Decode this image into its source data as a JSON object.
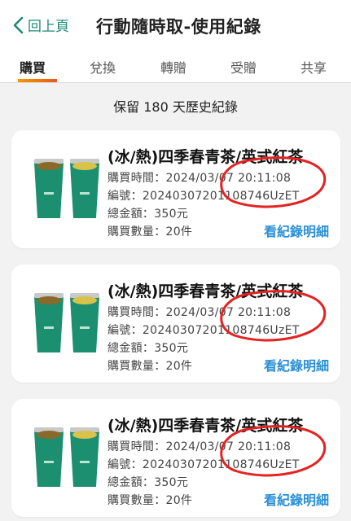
{
  "header": {
    "back_label": "回上頁",
    "title": "行動隨時取-使用紀錄"
  },
  "tabs": [
    {
      "label": "購買",
      "active": true
    },
    {
      "label": "兌換",
      "active": false
    },
    {
      "label": "轉贈",
      "active": false
    },
    {
      "label": "受贈",
      "active": false
    },
    {
      "label": "共享",
      "active": false
    }
  ],
  "retention_note": "保留 180 天歷史紀錄",
  "records": [
    {
      "product": "(冰/熱)四季春青茶/英式紅茶",
      "purchase_time": "購買時間：2024/03/07 20:11:08",
      "serial": "編號：20240307201108746UzET",
      "total": "總金額：350元",
      "quantity": "購買數量：20件",
      "detail_link": "看紀錄明細"
    },
    {
      "product": "(冰/熱)四季春青茶/英式紅茶",
      "purchase_time": "購買時間：2024/03/07 20:11:08",
      "serial": "編號：20240307201108746UzET",
      "total": "總金額：350元",
      "quantity": "購買數量：20件",
      "detail_link": "看紀錄明細"
    },
    {
      "product": "(冰/熱)四季春青茶/英式紅茶",
      "purchase_time": "購買時間：2024/03/07 20:11:08",
      "serial": "編號：20240307201108746UzET",
      "total": "總金額：350元",
      "quantity": "購買數量：20件",
      "detail_link": "看紀錄明細"
    }
  ],
  "colors": {
    "accent_green": "#1f8a73",
    "link_blue": "#2a8fd6",
    "tab_underline": "#f39800",
    "annotation_red": "#e52222"
  }
}
